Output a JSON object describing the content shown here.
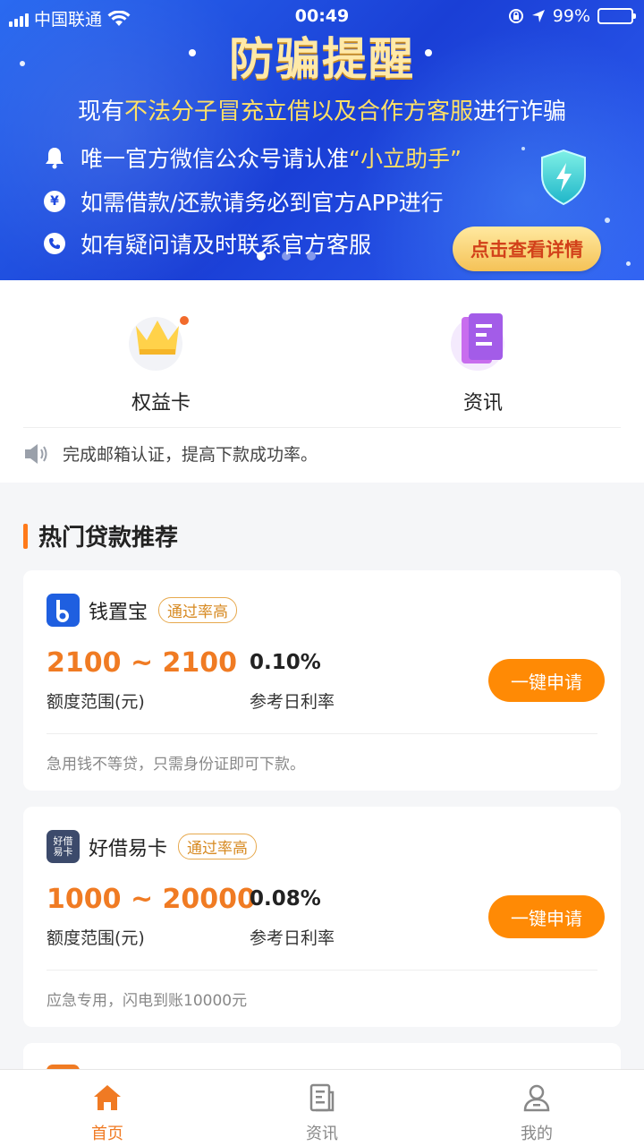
{
  "status_bar": {
    "carrier": "中国联通",
    "time": "00:49",
    "battery": "99%"
  },
  "banner": {
    "title": "防骗提醒",
    "line1_prefix": "现有",
    "line1_highlight": "不法分子冒充立借以及合作方客服",
    "line1_suffix": "进行诈骗",
    "item1_prefix": "唯一官方微信公众号请认准",
    "item1_highlight": "“小立助手”",
    "item2": "如需借款/还款请务必到官方APP进行",
    "item3": "如有疑问请及时联系官方客服",
    "detail_button": "点击查看详情",
    "yen_symbol": "¥"
  },
  "quick_menu": [
    {
      "label": "权益卡",
      "icon": "crown-icon"
    },
    {
      "label": "资讯",
      "icon": "document-icon"
    }
  ],
  "notice": {
    "text": "完成邮箱认证，提高下款成功率。"
  },
  "section": {
    "title": "热门贷款推荐"
  },
  "loans": [
    {
      "name": "钱置宝",
      "badge": "通过率高",
      "amount": "2100 ~ 2100",
      "amount_label": "额度范围(元)",
      "rate": "0.10%",
      "rate_label": "参考日利率",
      "apply": "一键申请",
      "desc": "急用钱不等贷，只需身份证即可下款。",
      "logo_text": "b",
      "logo_color": "#1f5fe0"
    },
    {
      "name": "好借易卡",
      "badge": "通过率高",
      "amount": "1000 ~ 20000",
      "amount_label": "额度范围(元)",
      "rate": "0.08%",
      "rate_label": "参考日利率",
      "apply": "一键申请",
      "desc": "应急专用，闪电到账10000元",
      "logo_text": "好借易卡",
      "logo_color": "#3c4a6b"
    }
  ],
  "tabbar": [
    {
      "label": "首页",
      "icon": "home-icon",
      "active": true
    },
    {
      "label": "资讯",
      "icon": "news-icon",
      "active": false
    },
    {
      "label": "我的",
      "icon": "profile-icon",
      "active": false
    }
  ],
  "colors": {
    "accent": "#f07a23",
    "button": "#ff8a05",
    "banner_blue": "#1a3fd6"
  }
}
